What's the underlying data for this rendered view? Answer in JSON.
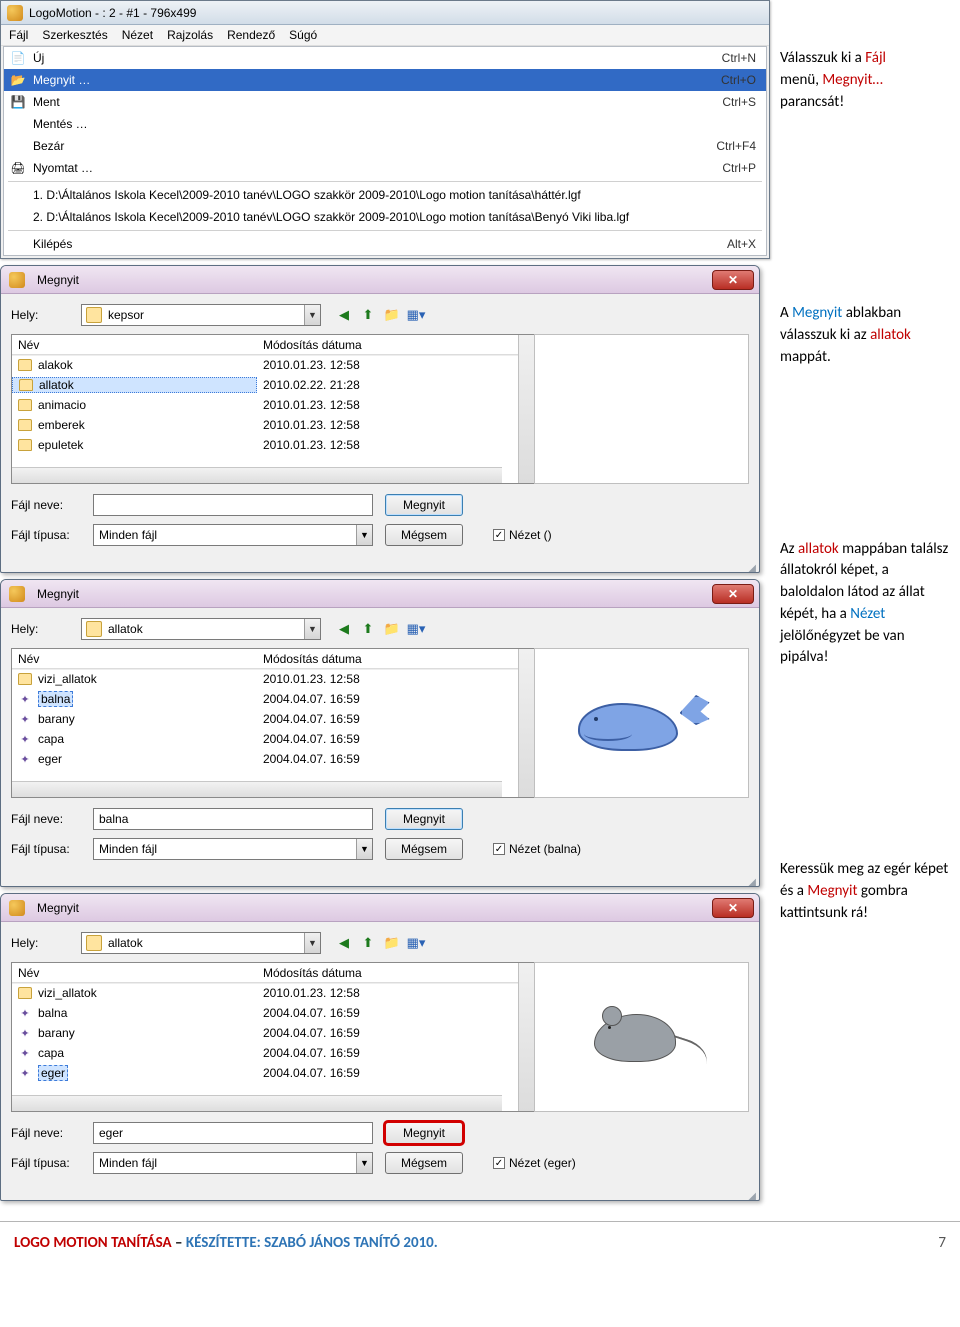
{
  "app": {
    "title": "LogoMotion - : 2 - #1 - 796x499",
    "menus": [
      "Fájl",
      "Szerkesztés",
      "Nézet",
      "Rajzolás",
      "Rendező",
      "Súgó"
    ],
    "submenu": [
      {
        "icon": "📄",
        "label": "Új",
        "short": "Ctrl+N"
      },
      {
        "icon": "📂",
        "label": "Megnyit …",
        "short": "Ctrl+O",
        "selected": true
      },
      {
        "icon": "💾",
        "label": "Ment",
        "short": "Ctrl+S"
      },
      {
        "icon": "",
        "label": "Mentés …",
        "short": ""
      },
      {
        "icon": "",
        "label": "Bezár",
        "short": "Ctrl+F4"
      },
      {
        "icon": "🖨",
        "label": "Nyomtat …",
        "short": "Ctrl+P"
      }
    ],
    "recent": [
      "1.  D:\\Általános Iskola Kecel\\2009-2010 tanév\\LOGO szakkör 2009-2010\\Logo motion tanítása\\háttér.lgf",
      "2.  D:\\Általános Iskola Kecel\\2009-2010 tanév\\LOGO szakkör 2009-2010\\Logo motion tanítása\\Benyó Viki liba.lgf"
    ],
    "exit": {
      "label": "Kilépés",
      "short": "Alt+X"
    }
  },
  "annot1": {
    "p1": "Válasszuk ki a ",
    "r1": "Fájl",
    "p2": "menü, ",
    "r2": "Megnyit…",
    "p3": "parancsát!"
  },
  "annot2": {
    "p1": "A ",
    "b1": "Megnyit",
    "p2": " ablakban válasszuk ki az ",
    "r1": "allatok",
    "p3": "mappát."
  },
  "annot3": {
    "p1": "Az ",
    "r1": "allatok",
    "p2": " mappában találsz állatokról képet, a baloldalon látod az állat képét, ha a ",
    "b1": "Nézet",
    "p3": "jelölőnégyzet be van pipálva!"
  },
  "annot4": {
    "p1": "Keressük meg az egér képet és a ",
    "r1": "Megnyit",
    "p2": " gombra kattintsunk rá!"
  },
  "dlg": {
    "title": "Megnyit",
    "helyLabel": "Hely:",
    "nevLabel": "Fájl neve:",
    "tipusLabel": "Fájl típusa:",
    "fileType": "Minden fájl",
    "openBtn": "Megnyit",
    "cancelBtn": "Mégsem",
    "headerName": "Név",
    "headerMod": "Módosítás dátuma"
  },
  "dlg1": {
    "folder": "kepsor",
    "rows": [
      {
        "type": "folder",
        "name": "alakok",
        "date": "2010.01.23. 12:58"
      },
      {
        "type": "folder",
        "name": "allatok",
        "date": "2010.02.22. 21:28",
        "sel": true
      },
      {
        "type": "folder",
        "name": "animacio",
        "date": "2010.01.23. 12:58"
      },
      {
        "type": "folder",
        "name": "emberek",
        "date": "2010.01.23. 12:58"
      },
      {
        "type": "folder",
        "name": "epuletek",
        "date": "2010.01.23. 12:58"
      }
    ],
    "fileName": "",
    "viewLabel": "Nézet ()"
  },
  "dlg2": {
    "folder": "allatok",
    "rows": [
      {
        "type": "folder",
        "name": "vizi_allatok",
        "date": "2010.01.23. 12:58"
      },
      {
        "type": "lgf",
        "name": "balna",
        "date": "2004.04.07. 16:59",
        "sel": true
      },
      {
        "type": "lgf",
        "name": "barany",
        "date": "2004.04.07. 16:59"
      },
      {
        "type": "lgf",
        "name": "capa",
        "date": "2004.04.07. 16:59"
      },
      {
        "type": "lgf",
        "name": "eger",
        "date": "2004.04.07. 16:59"
      }
    ],
    "fileName": "balna",
    "viewLabel": "Nézet (balna)"
  },
  "dlg3": {
    "folder": "allatok",
    "rows": [
      {
        "type": "folder",
        "name": "vizi_allatok",
        "date": "2010.01.23. 12:58"
      },
      {
        "type": "lgf",
        "name": "balna",
        "date": "2004.04.07. 16:59"
      },
      {
        "type": "lgf",
        "name": "barany",
        "date": "2004.04.07. 16:59"
      },
      {
        "type": "lgf",
        "name": "capa",
        "date": "2004.04.07. 16:59"
      },
      {
        "type": "lgf",
        "name": "eger",
        "date": "2004.04.07. 16:59",
        "sel": true
      }
    ],
    "fileName": "eger",
    "viewLabel": "Nézet (eger)"
  },
  "footer": {
    "leftRed": "LOGO MOTION TANÍTÁSA",
    "leftDash": " – ",
    "leftBlue": "KÉSZÍTETTE: SZABÓ JÁNOS TANÍTÓ 2010.",
    "pageNum": "7"
  }
}
